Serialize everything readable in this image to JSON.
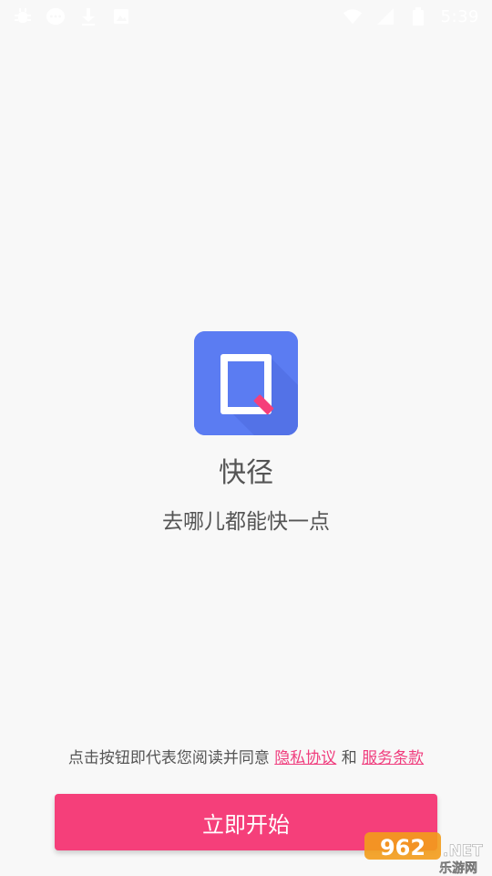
{
  "status_bar": {
    "time": "5:39",
    "left_icons": [
      "bug-icon",
      "chat-bubble-icon",
      "download-icon",
      "photo-icon"
    ],
    "right_icons": [
      "wifi-icon",
      "signal-icon",
      "battery-icon"
    ]
  },
  "app": {
    "name": "快径",
    "slogan": "去哪儿都能快一点",
    "logo_color": "#5b7cf2"
  },
  "agreement": {
    "prefix": "点击按钮即代表您阅读并同意 ",
    "privacy_link": "隐私协议",
    "joiner": " 和 ",
    "terms_link": "服务条款",
    "link_color": "#f03c7d"
  },
  "start_button": {
    "label": "立即开始",
    "color": "#f53f7a"
  },
  "watermark": {
    "number": "962",
    "suffix": ".NET",
    "site": "乐游网"
  }
}
